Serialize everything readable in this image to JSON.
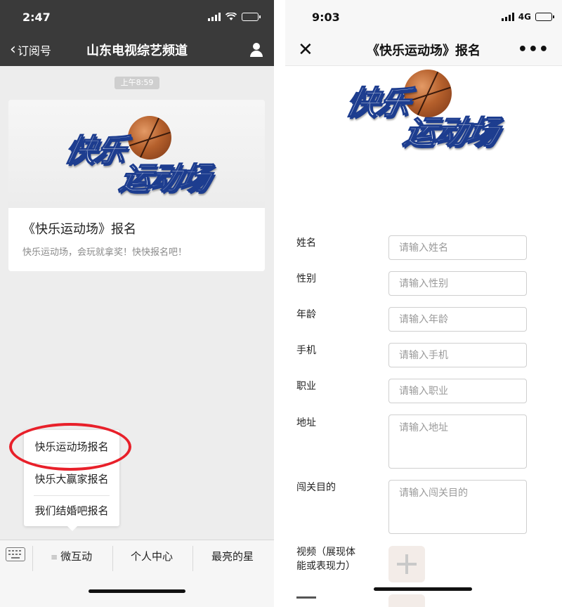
{
  "left": {
    "status": {
      "time": "2:47"
    },
    "nav": {
      "back_label": "订阅号",
      "title": "山东电视综艺频道"
    },
    "timestamp": "上午8:59",
    "card": {
      "logo_line1": "快乐",
      "logo_line2": "运动场",
      "title": "《快乐运动场》报名",
      "desc": "快乐运动场，会玩就拿奖！快快报名吧！"
    },
    "menu": {
      "items": [
        "快乐运动场报名",
        "快乐大赢家报名",
        "我们结婚吧报名"
      ]
    },
    "bottom_tabs": [
      "微互动",
      "个人中心",
      "最亮的星"
    ]
  },
  "right": {
    "status": {
      "time": "9:03",
      "network": "4G"
    },
    "nav": {
      "title": "《快乐运动场》报名"
    },
    "logo_line1": "快乐",
    "logo_line2": "运动场",
    "form": {
      "name_label": "姓名",
      "name_placeholder": "请输入姓名",
      "gender_label": "性别",
      "gender_placeholder": "请输入性别",
      "age_label": "年龄",
      "age_placeholder": "请输入年龄",
      "phone_label": "手机",
      "phone_placeholder": "请输入手机",
      "job_label": "职业",
      "job_placeholder": "请输入职业",
      "address_label": "地址",
      "address_placeholder": "请输入地址",
      "purpose_label": "闯关目的",
      "purpose_placeholder": "请输入闯关目的",
      "video_label_line1": "视频（展现体",
      "video_label_line2": "能或表现力）"
    }
  },
  "colors": {
    "dark_nav": "#3a3a3a",
    "highlight_ring": "#e8202a",
    "logo_outline": "#1d3d8f",
    "battery_charging": "#3cc13c"
  },
  "icons": [
    "back-chevron-icon",
    "profile-icon",
    "keyboard-icon",
    "menu-lines-icon",
    "close-icon",
    "more-icon",
    "signal-icon",
    "wifi-icon",
    "battery-icon",
    "add-icon",
    "basketball-icon"
  ]
}
